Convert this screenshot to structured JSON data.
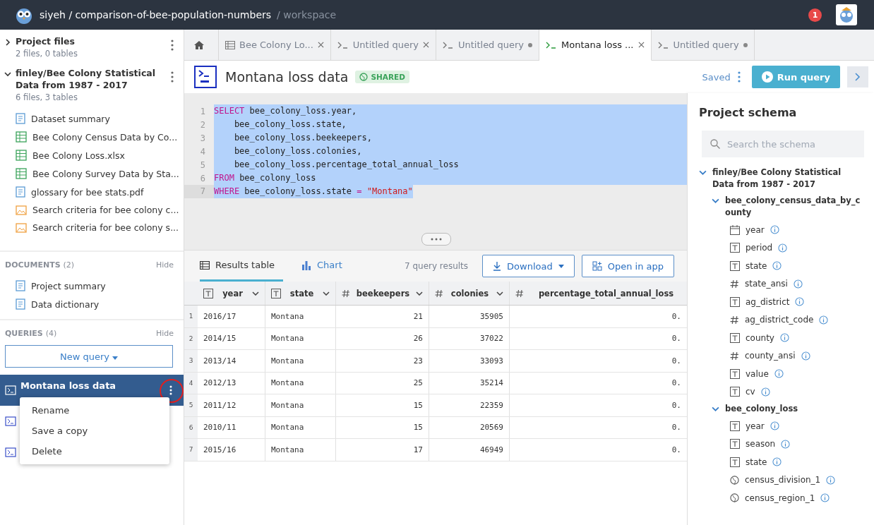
{
  "header": {
    "path": "siyeh / comparison-of-bee-population-numbers",
    "section": "/ workspace",
    "notification_count": "1"
  },
  "sidebar": {
    "datasets": [
      {
        "title": "Project files",
        "subtitle": "2 files, 0 tables",
        "expanded": false
      },
      {
        "title": "finley/Bee Colony Statistical Data from 1987 - 2017",
        "subtitle": "6 files, 3 tables",
        "expanded": true,
        "files": [
          {
            "name": "Dataset summary",
            "kind": "doc"
          },
          {
            "name": "Bee Colony Census Data by Co...",
            "kind": "table"
          },
          {
            "name": "Bee Colony Loss.xlsx",
            "kind": "table"
          },
          {
            "name": "Bee Colony Survey Data by Sta...",
            "kind": "table"
          },
          {
            "name": "glossary for bee stats.pdf",
            "kind": "doc"
          },
          {
            "name": "Search criteria for bee colony c...",
            "kind": "image"
          },
          {
            "name": "Search criteria for bee colony s...",
            "kind": "image"
          }
        ]
      }
    ],
    "documents": {
      "label": "DOCUMENTS",
      "count": "(2)",
      "hide": "Hide",
      "items": [
        "Project summary",
        "Data dictionary"
      ]
    },
    "queries": {
      "label": "QUERIES",
      "count": "(4)",
      "hide": "Hide",
      "new_button": "New query",
      "items": [
        {
          "title": "Montana loss data",
          "selected": true
        },
        {
          "selected": false
        },
        {
          "selected": false
        }
      ]
    },
    "context_menu": [
      "Rename",
      "Save a copy",
      "Delete"
    ]
  },
  "tabs": [
    {
      "label": "Bee Colony Lo...",
      "kind": "table",
      "unsaved": false,
      "selected": false
    },
    {
      "label": "Untitled query",
      "kind": "query",
      "unsaved": false,
      "selected": false
    },
    {
      "label": "Untitled query",
      "kind": "query",
      "unsaved": true,
      "selected": false
    },
    {
      "label": "Montana loss ...",
      "kind": "query",
      "unsaved": false,
      "selected": true
    },
    {
      "label": "Untitled query",
      "kind": "query",
      "unsaved": true,
      "selected": false
    }
  ],
  "query": {
    "title": "Montana loss data",
    "badge": "SHARED",
    "status": "Saved",
    "run_button": "Run query",
    "code": [
      {
        "n": "1",
        "parts": [
          {
            "text": "SELECT",
            "kind": "keyword"
          },
          {
            "text": " bee_colony_loss.year,",
            "kind": "plain"
          }
        ]
      },
      {
        "n": "2",
        "parts": [
          {
            "text": "    bee_colony_loss.state,",
            "kind": "plain"
          }
        ]
      },
      {
        "n": "3",
        "parts": [
          {
            "text": "    bee_colony_loss.beekeepers,",
            "kind": "plain"
          }
        ]
      },
      {
        "n": "4",
        "parts": [
          {
            "text": "    bee_colony_loss.colonies,",
            "kind": "plain"
          }
        ]
      },
      {
        "n": "5",
        "parts": [
          {
            "text": "    bee_colony_loss.percentage_total_annual_loss",
            "kind": "plain"
          }
        ]
      },
      {
        "n": "6",
        "parts": [
          {
            "text": "FROM",
            "kind": "keyword"
          },
          {
            "text": " bee_colony_loss",
            "kind": "plain"
          }
        ]
      },
      {
        "n": "7",
        "parts": [
          {
            "text": "WHERE",
            "kind": "keyword"
          },
          {
            "text": " bee_colony_loss.state ",
            "kind": "plain"
          },
          {
            "text": "=",
            "kind": "keyword"
          },
          {
            "text": " \"Montana\"",
            "kind": "string"
          }
        ]
      }
    ]
  },
  "results": {
    "tabs": [
      {
        "label": "Results table",
        "selected": true
      },
      {
        "label": "Chart",
        "selected": false
      }
    ],
    "count": "7 query results",
    "download": "Download",
    "open_in_app": "Open in app",
    "columns": [
      {
        "name": "year",
        "kind": "text"
      },
      {
        "name": "state",
        "kind": "text"
      },
      {
        "name": "beekeepers",
        "kind": "number"
      },
      {
        "name": "colonies",
        "kind": "number"
      },
      {
        "name": "percentage_total_annual_loss",
        "kind": "number"
      }
    ],
    "rows": [
      {
        "n": "1",
        "cells": [
          "2016/17",
          "Montana",
          "21",
          "35905",
          "0."
        ]
      },
      {
        "n": "2",
        "cells": [
          "2014/15",
          "Montana",
          "26",
          "37022",
          "0."
        ]
      },
      {
        "n": "3",
        "cells": [
          "2013/14",
          "Montana",
          "23",
          "33093",
          "0."
        ]
      },
      {
        "n": "4",
        "cells": [
          "2012/13",
          "Montana",
          "25",
          "35214",
          "0."
        ]
      },
      {
        "n": "5",
        "cells": [
          "2011/12",
          "Montana",
          "15",
          "22359",
          "0."
        ]
      },
      {
        "n": "6",
        "cells": [
          "2010/11",
          "Montana",
          "15",
          "20569",
          "0."
        ]
      },
      {
        "n": "7",
        "cells": [
          "2015/16",
          "Montana",
          "17",
          "46949",
          "0."
        ]
      }
    ]
  },
  "schema": {
    "title": "Project schema",
    "search_placeholder": "Search the schema",
    "dataset": {
      "name": "finley/Bee Colony Statistical Data from 1987 - 2017",
      "expanded": true,
      "tables": [
        {
          "name": "bee_colony_census_data_by_county",
          "expanded": true,
          "columns": [
            {
              "name": "year",
              "kind": "date"
            },
            {
              "name": "period",
              "kind": "text"
            },
            {
              "name": "state",
              "kind": "text"
            },
            {
              "name": "state_ansi",
              "kind": "number"
            },
            {
              "name": "ag_district",
              "kind": "text"
            },
            {
              "name": "ag_district_code",
              "kind": "number"
            },
            {
              "name": "county",
              "kind": "text"
            },
            {
              "name": "county_ansi",
              "kind": "number"
            },
            {
              "name": "value",
              "kind": "text"
            },
            {
              "name": "cv",
              "kind": "text"
            }
          ]
        },
        {
          "name": "bee_colony_loss",
          "expanded": true,
          "columns": [
            {
              "name": "year",
              "kind": "text"
            },
            {
              "name": "season",
              "kind": "text"
            },
            {
              "name": "state",
              "kind": "text"
            },
            {
              "name": "census_division_1",
              "kind": "geo"
            },
            {
              "name": "census_region_1",
              "kind": "geo"
            }
          ]
        }
      ]
    }
  }
}
